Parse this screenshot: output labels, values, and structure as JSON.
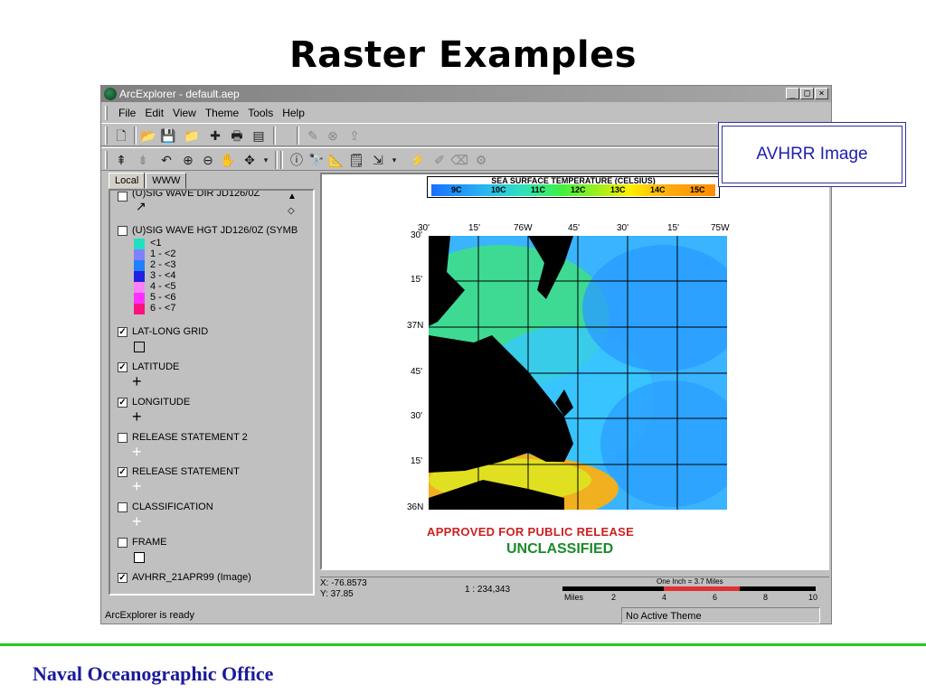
{
  "slide": {
    "title": "Raster Examples",
    "footer": "Naval Oceanographic Office"
  },
  "window": {
    "title": "ArcExplorer - default.aep",
    "buttons": {
      "minimize": "_",
      "maximize": "□",
      "close": "×"
    }
  },
  "menu": [
    "File",
    "Edit",
    "View",
    "Theme",
    "Tools",
    "Help"
  ],
  "tabs": [
    "Local",
    "WWW"
  ],
  "layers": [
    {
      "name": "(U)SIG WAVE DIR JD126/0Z",
      "checked": false
    },
    {
      "name": "(U)SIG WAVE HGT JD126/0Z (SYMB",
      "checked": false,
      "classes": [
        {
          "label": "<1",
          "color": "#20e0c0"
        },
        {
          "label": "1 - <2",
          "color": "#8080ff"
        },
        {
          "label": "2 - <3",
          "color": "#2080ff"
        },
        {
          "label": "3 - <4",
          "color": "#2020e0"
        },
        {
          "label": "4 - <5",
          "color": "#ff80ff"
        },
        {
          "label": "5 - <6",
          "color": "#ff30ff"
        },
        {
          "label": "6 - <7",
          "color": "#ff1080"
        }
      ]
    },
    {
      "name": "LAT-LONG GRID",
      "checked": true
    },
    {
      "name": "LATITUDE",
      "checked": true
    },
    {
      "name": "LONGITUDE",
      "checked": true
    },
    {
      "name": "RELEASE STATEMENT 2",
      "checked": false
    },
    {
      "name": "RELEASE STATEMENT",
      "checked": true
    },
    {
      "name": "CLASSIFICATION",
      "checked": false
    },
    {
      "name": "FRAME",
      "checked": false
    },
    {
      "name": "AVHRR_21APR99 (Image)",
      "checked": true
    }
  ],
  "sst_legend": {
    "title": "SEA SURFACE TEMPERATURE (CELSIUS)",
    "ticks": [
      "9C",
      "10C",
      "11C",
      "12C",
      "13C",
      "14C",
      "15C"
    ]
  },
  "map": {
    "lon_labels": [
      "30'",
      "15'",
      "76W",
      "45'",
      "30'",
      "15'",
      "75W"
    ],
    "lat_labels": [
      "30'",
      "15'",
      "37N",
      "45'",
      "30'",
      "15'",
      "36N"
    ],
    "approved": "APPROVED FOR PUBLIC RELEASE",
    "classification": "UNCLASSIFIED"
  },
  "callout": {
    "text": "AVHRR Image"
  },
  "coords": {
    "x": "X: -76.8573",
    "y": "Y: 37.85",
    "scale": "1 : 234,343"
  },
  "scalebar": {
    "caption": "One Inch = 3.7 Miles",
    "unit": "Miles",
    "ticks": [
      "2",
      "4",
      "6",
      "8",
      "10"
    ]
  },
  "status": {
    "left": "ArcExplorer is ready",
    "right": "No Active Theme"
  }
}
